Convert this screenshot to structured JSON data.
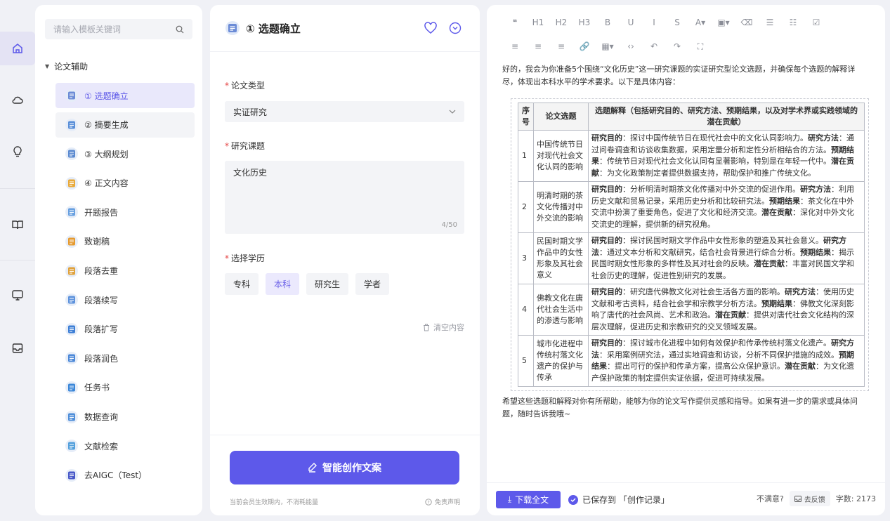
{
  "sidebar_rail": {
    "items": [
      {
        "name": "home-icon"
      },
      {
        "name": "cloud-icon"
      },
      {
        "name": "lightbulb-icon"
      },
      {
        "name": "book-icon"
      },
      {
        "name": "monitor-icon"
      },
      {
        "name": "inbox-icon"
      }
    ]
  },
  "templates": {
    "search_placeholder": "请输入模板关键词",
    "group_title": "论文辅助",
    "items": [
      {
        "label": "① 选题确立",
        "color": "#6b8bd6"
      },
      {
        "label": "② 摘要生成",
        "color": "#5a8fd8"
      },
      {
        "label": "③ 大纲规划",
        "color": "#5b8ad0"
      },
      {
        "label": "④ 正文内容",
        "color": "#e8a93a"
      },
      {
        "label": "开题报告",
        "color": "#68a0e0"
      },
      {
        "label": "致谢稿",
        "color": "#e59a2f"
      },
      {
        "label": "段落去重",
        "color": "#e0a23c"
      },
      {
        "label": "段落续写",
        "color": "#5d92dc"
      },
      {
        "label": "段落扩写",
        "color": "#3d7fd6"
      },
      {
        "label": "段落润色",
        "color": "#4d89d8"
      },
      {
        "label": "任务书",
        "color": "#3a86d8"
      },
      {
        "label": "数据查询",
        "color": "#4f8ed9"
      },
      {
        "label": "文献检索",
        "color": "#53a0dc"
      },
      {
        "label": "去AIGC（Test）",
        "color": "#4858c8"
      }
    ]
  },
  "form": {
    "title": "① 选题确立",
    "type_label": "论文类型",
    "type_value": "实证研究",
    "topic_label": "研究课题",
    "topic_value": "文化历史",
    "topic_counter": "4/50",
    "edu_label": "选择学历",
    "edu_options": [
      "专科",
      "本科",
      "研究生",
      "学者"
    ],
    "clear_label": "清空内容",
    "generate_label": "智能创作文案",
    "member_note": "当前会员生效期内，不消耗能量",
    "disclaimer": "免责声明"
  },
  "editor": {
    "toolbar_row1": [
      "❝",
      "H1",
      "H2",
      "H3",
      "B",
      "U",
      "I",
      "S",
      "A▾",
      "▣▾",
      "⌫",
      "☰",
      "☷",
      "☑"
    ],
    "toolbar_row2": [
      "≡",
      "≡",
      "≡",
      "🔗",
      "▦▾",
      "‹›",
      "↶",
      "↷",
      "⛶"
    ],
    "intro": "好的，我会为你准备5个围绕“文化历史”这一研究课题的实证研究型论文选题，并确保每个选题的解释详尽，体现出本科水平的学术要求。以下是具体内容：",
    "table_headers": [
      "序号",
      "论文选题",
      "选题解释（包括研究目的、研究方法、预期结果，以及对学术界或实践领域的潜在贡献）"
    ],
    "rows": [
      {
        "num": "1",
        "topic": "中国传统节日对现代社会文化认同的影响",
        "purpose": "探讨中国传统节日在现代社会中的文化认同影响力。",
        "method": "通过问卷调查和访谈收集数据，采用定量分析和定性分析相结合的方法。",
        "result": "传统节日对现代社会文化认同有显著影响，特别是在年轻一代中。",
        "contrib": "为文化政策制定者提供数据支持，帮助保护和推广传统文化。"
      },
      {
        "num": "2",
        "topic": "明清时期的茶文化传播对中外交流的影响",
        "purpose": "分析明清时期茶文化传播对中外交流的促进作用。",
        "method": "利用历史文献和贸易记录，采用历史分析和比较研究法。",
        "result": "茶文化在中外交流中扮演了重要角色，促进了文化和经济交流。",
        "contrib": "深化对中外文化交流史的理解，提供新的研究视角。"
      },
      {
        "num": "3",
        "topic": "民国时期文学作品中的女性形象及其社会意义",
        "purpose": "探讨民国时期文学作品中女性形象的塑造及其社会意义。",
        "method": "通过文本分析和文献研究，结合社会背景进行综合分析。",
        "result": "揭示民国时期女性形象的多样性及其对社会的反映。",
        "contrib": "丰富对民国文学和社会历史的理解，促进性别研究的发展。"
      },
      {
        "num": "4",
        "topic": "佛教文化在唐代社会生活中的渗透与影响",
        "purpose": "研究唐代佛教文化对社会生活各方面的影响。",
        "method": "使用历史文献和考古资料，结合社会学和宗教学分析方法。",
        "result": "佛教文化深刻影响了唐代的社会风尚、艺术和政治。",
        "contrib": "提供对唐代社会文化结构的深层次理解，促进历史和宗教研究的交叉领域发展。"
      },
      {
        "num": "5",
        "topic": "城市化进程中传统村落文化遗产的保护与传承",
        "purpose": "探讨城市化进程中如何有效保护和传承传统村落文化遗产。",
        "method": "采用案例研究法，通过实地调查和访谈，分析不同保护措施的成效。",
        "result": "提出可行的保护和传承方案，提高公众保护意识。",
        "contrib": "为文化遗产保护政策的制定提供实证依据，促进可持续发展。"
      }
    ],
    "kw_purpose": "研究目的",
    "kw_method": "研究方法",
    "kw_result": "预期结果",
    "kw_contrib": "潜在贡献",
    "outro": "希望这些选题和解释对你有所帮助，能够为你的论文写作提供灵感和指导。如果有进一步的需求或具体问题，随时告诉我哦~",
    "download_label": "下载全文",
    "saved_label": "已保存到 「创作记录」",
    "unsatisfied_label": "不满意?",
    "feedback_label": "去反馈",
    "word_count_label": "字数: 2173"
  },
  "colors": {
    "accent": "#5d59ea",
    "required": "#e54545"
  }
}
